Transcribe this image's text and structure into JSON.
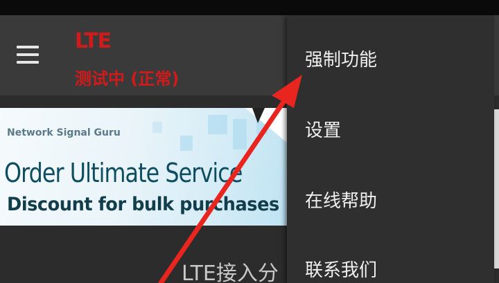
{
  "header": {
    "network_type": "LTE",
    "test_status": "测试中 (正常)"
  },
  "banner": {
    "brand": "Network Signal Guru",
    "headline": "Order Ultimate Service",
    "subline": "Discount for bulk purchases"
  },
  "content": {
    "section_heading": "LTE接入分"
  },
  "menu": {
    "items": [
      {
        "label": "强制功能"
      },
      {
        "label": "设置"
      },
      {
        "label": "在线帮助"
      },
      {
        "label": "联系我们"
      }
    ]
  },
  "colors": {
    "accent_red": "#d11a1a",
    "app_bar": "#3a3a3a",
    "menu_bg": "#2f2f2f"
  },
  "icons": [
    "hamburger-menu-icon"
  ]
}
